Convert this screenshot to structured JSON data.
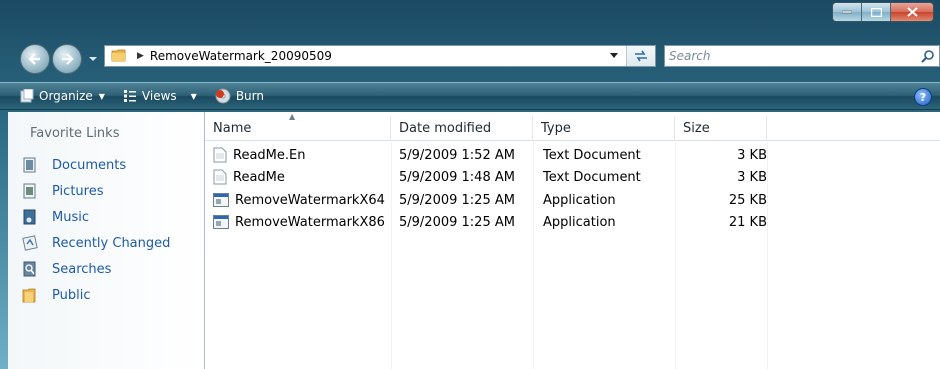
{
  "window": {
    "controls": [
      "minimize",
      "maximize",
      "close"
    ]
  },
  "address": {
    "path_segment": "RemoveWatermark_20090509"
  },
  "search": {
    "placeholder": "Search"
  },
  "toolbar": {
    "organize_label": "Organize",
    "views_label": "Views",
    "burn_label": "Burn",
    "help_label": "?"
  },
  "sidebar": {
    "title": "Favorite Links",
    "items": [
      {
        "label": "Documents",
        "icon": "documents-icon"
      },
      {
        "label": "Pictures",
        "icon": "pictures-icon"
      },
      {
        "label": "Music",
        "icon": "music-icon"
      },
      {
        "label": "Recently Changed",
        "icon": "recently-changed-icon"
      },
      {
        "label": "Searches",
        "icon": "searches-icon"
      },
      {
        "label": "Public",
        "icon": "public-folder-icon"
      }
    ]
  },
  "columns": {
    "name": "Name",
    "date": "Date modified",
    "type": "Type",
    "size": "Size"
  },
  "files": [
    {
      "name": "ReadMe.En",
      "date": "5/9/2009 1:52 AM",
      "type": "Text Document",
      "size": "3 KB",
      "icon": "text-document-icon"
    },
    {
      "name": "ReadMe",
      "date": "5/9/2009 1:48 AM",
      "type": "Text Document",
      "size": "3 KB",
      "icon": "text-document-icon"
    },
    {
      "name": "RemoveWatermarkX64",
      "date": "5/9/2009 1:25 AM",
      "type": "Application",
      "size": "25 KB",
      "icon": "application-icon"
    },
    {
      "name": "RemoveWatermarkX86",
      "date": "5/9/2009 1:25 AM",
      "type": "Application",
      "size": "21 KB",
      "icon": "application-icon"
    }
  ],
  "colors": {
    "link": "#1d5aa8",
    "toolbar": "#2d6076"
  }
}
